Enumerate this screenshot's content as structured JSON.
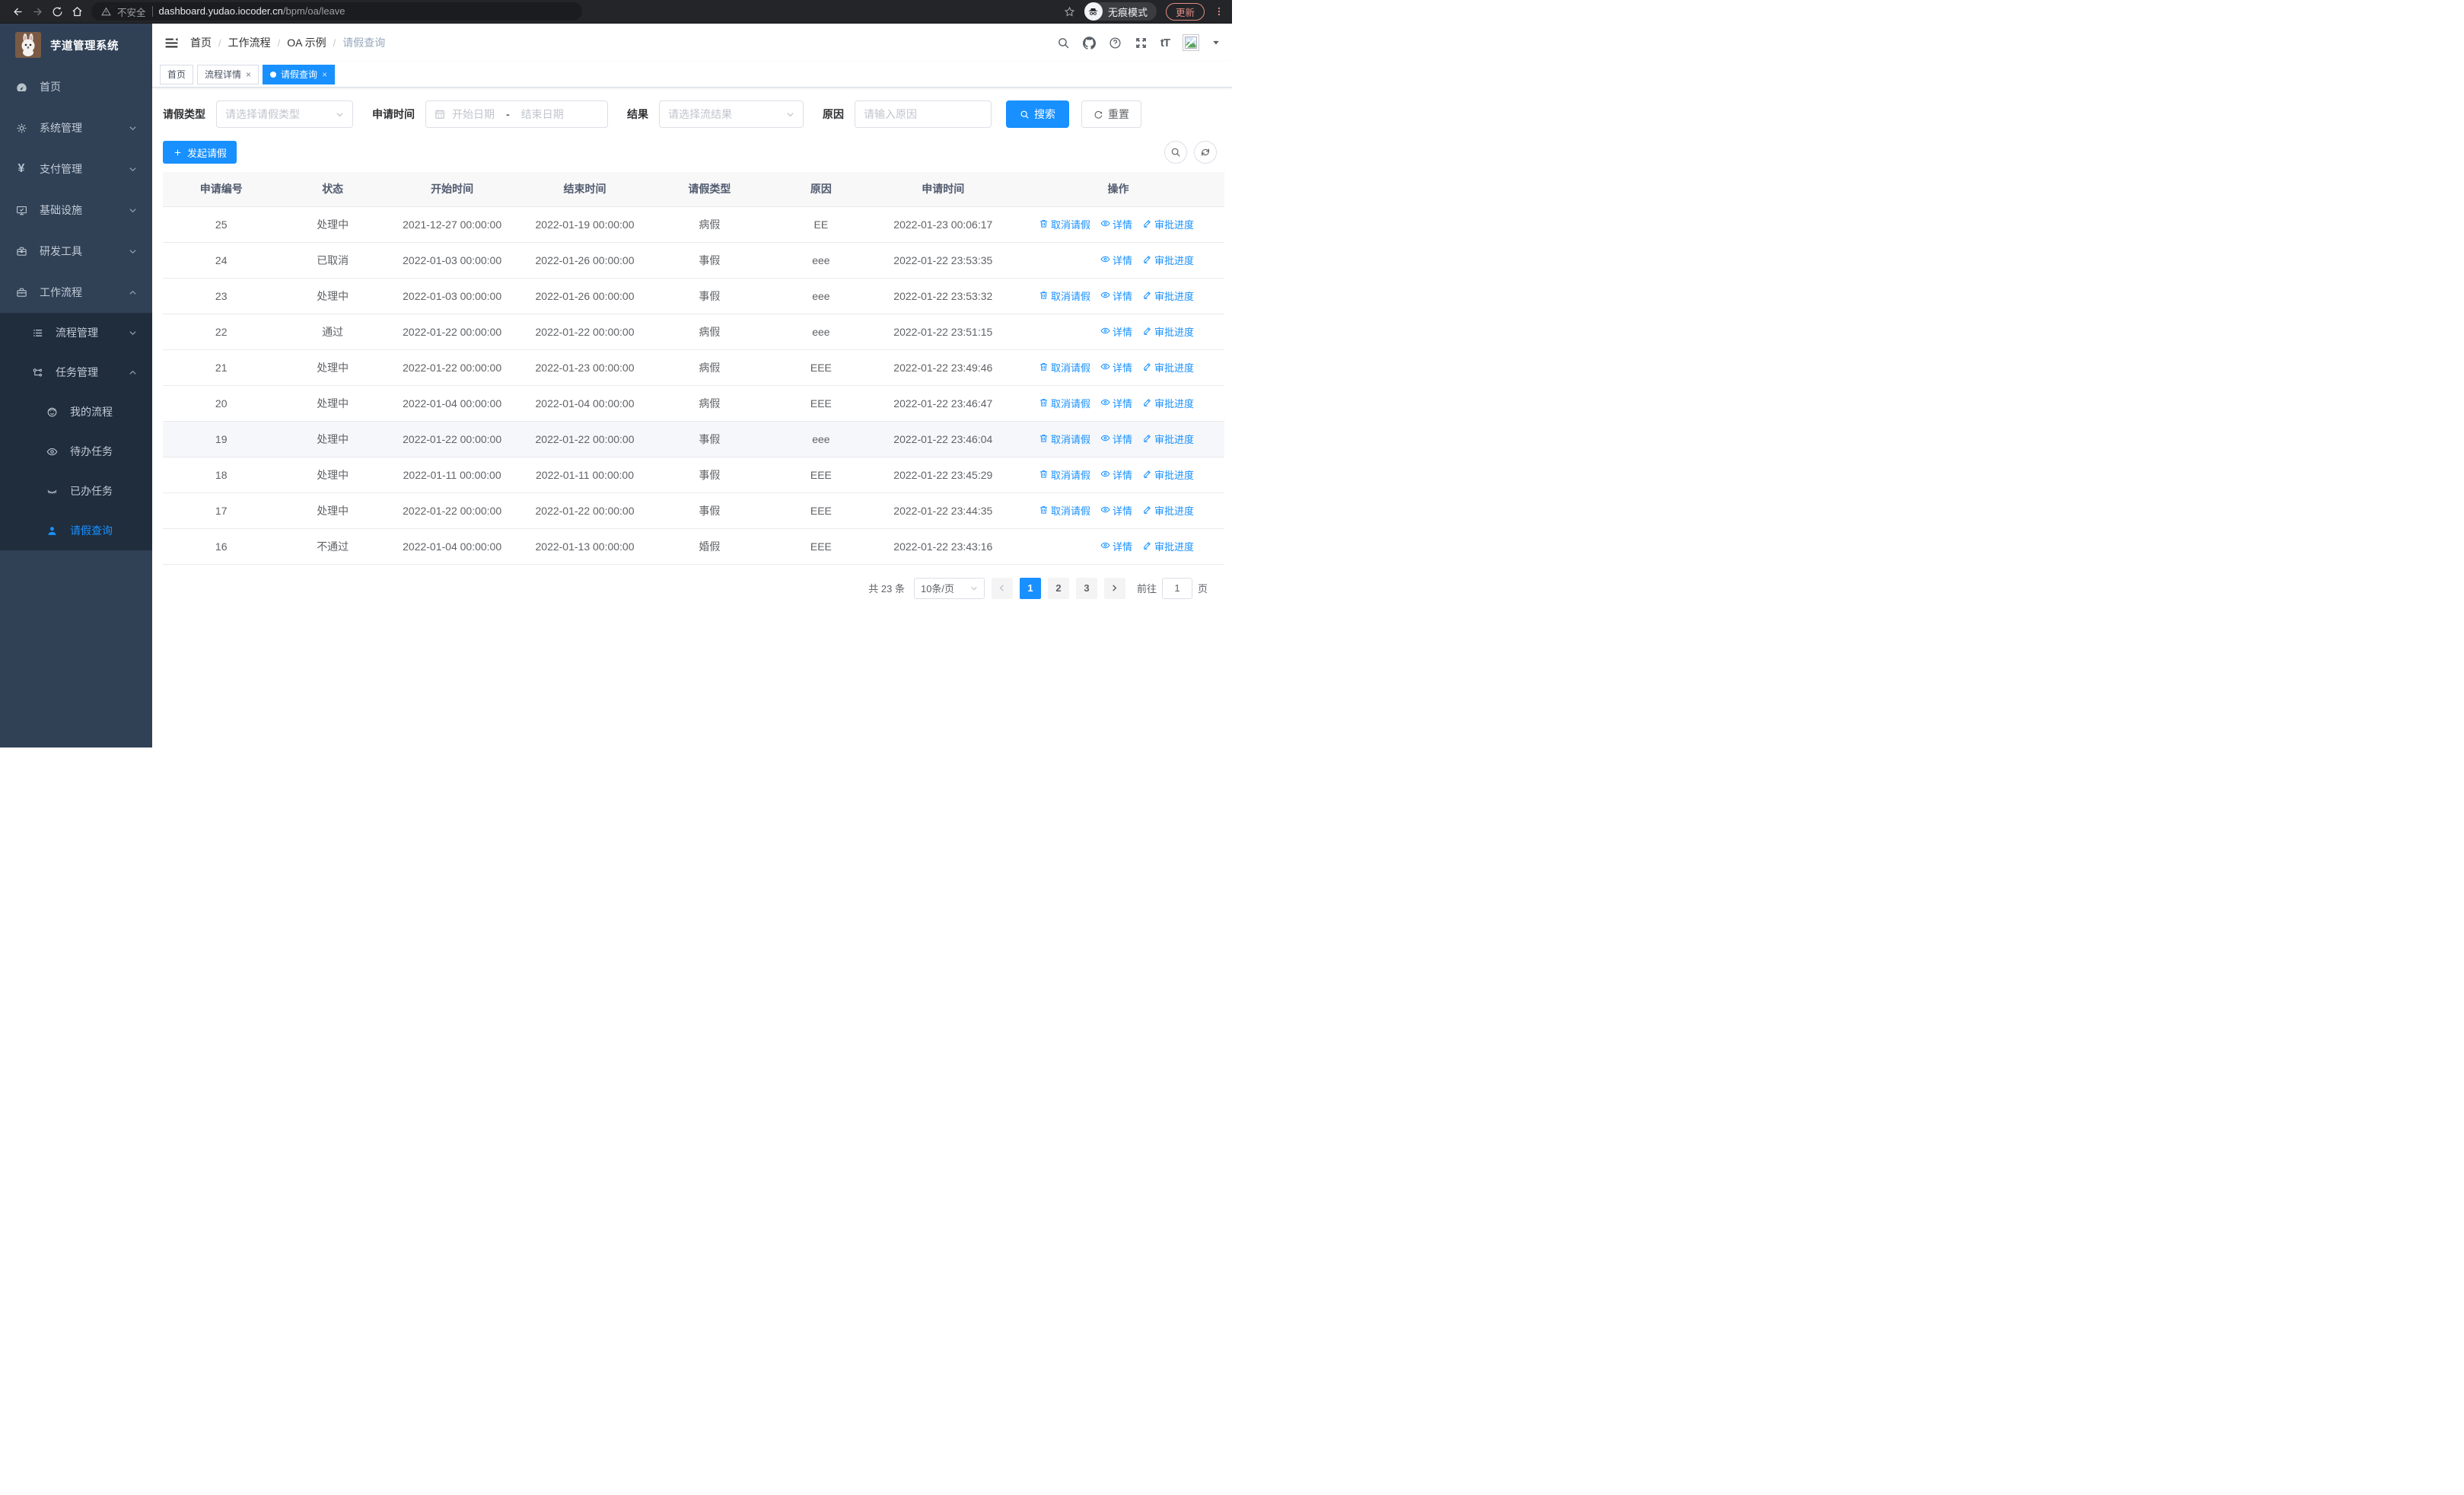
{
  "colors": {
    "accent": "#1890ff",
    "sidebar_bg": "#304156",
    "submenu_bg": "#1f2d3d"
  },
  "browser": {
    "security_label": "不安全",
    "url_host": "dashboard.yudao.iocoder.cn",
    "url_path": "/bpm/oa/leave",
    "incognito_label": "无痕模式",
    "update_label": "更新"
  },
  "sidebar": {
    "app_title": "芋道管理系统",
    "items": [
      {
        "label": "首页",
        "icon": "gauge-icon",
        "level": 1,
        "chevron": "",
        "active": false
      },
      {
        "label": "系统管理",
        "icon": "gear-icon",
        "level": 1,
        "chevron": "down",
        "active": false
      },
      {
        "label": "支付管理",
        "icon": "yen-icon",
        "level": 1,
        "chevron": "down",
        "active": false
      },
      {
        "label": "基础设施",
        "icon": "monitor-icon",
        "level": 1,
        "chevron": "down",
        "active": false
      },
      {
        "label": "研发工具",
        "icon": "toolbox-icon",
        "level": 1,
        "chevron": "down",
        "active": false
      },
      {
        "label": "工作流程",
        "icon": "briefcase-icon",
        "level": 1,
        "chevron": "up",
        "active": false
      },
      {
        "label": "流程管理",
        "icon": "tree-list-icon",
        "level": 2,
        "chevron": "down",
        "active": false
      },
      {
        "label": "任务管理",
        "icon": "flow-icon",
        "level": 2,
        "chevron": "up",
        "active": false
      },
      {
        "label": "我的流程",
        "icon": "face-icon",
        "level": 3,
        "chevron": "",
        "active": false
      },
      {
        "label": "待办任务",
        "icon": "eye-open-icon",
        "level": 3,
        "chevron": "",
        "active": false
      },
      {
        "label": "已办任务",
        "icon": "eye-closed-icon",
        "level": 3,
        "chevron": "",
        "active": false
      },
      {
        "label": "请假查询",
        "icon": "user-icon",
        "level": 3,
        "chevron": "",
        "active": true
      }
    ]
  },
  "breadcrumb": {
    "items": [
      "首页",
      "工作流程",
      "OA 示例",
      "请假查询"
    ]
  },
  "tabs": [
    {
      "label": "首页",
      "closable": false,
      "active": false
    },
    {
      "label": "流程详情",
      "closable": true,
      "active": false
    },
    {
      "label": "请假查询",
      "closable": true,
      "active": true
    }
  ],
  "filters": {
    "leave_type_label": "请假类型",
    "leave_type_placeholder": "请选择请假类型",
    "apply_time_label": "申请时间",
    "date_start_placeholder": "开始日期",
    "date_separator": "-",
    "date_end_placeholder": "结束日期",
    "result_label": "结果",
    "result_placeholder": "请选择流结果",
    "reason_label": "原因",
    "reason_placeholder": "请输入原因",
    "search_label": "搜索",
    "reset_label": "重置"
  },
  "toolbar": {
    "create_label": "发起请假"
  },
  "table": {
    "columns": [
      "申请编号",
      "状态",
      "开始时间",
      "结束时间",
      "请假类型",
      "原因",
      "申请时间",
      "操作"
    ],
    "action_labels": {
      "cancel": "取消请假",
      "detail": "详情",
      "progress": "审批进度"
    },
    "rows": [
      {
        "id": "25",
        "status": "处理中",
        "start": "2021-12-27 00:00:00",
        "end": "2022-01-19 00:00:00",
        "type": "病假",
        "reason": "EE",
        "apply_time": "2022-01-23 00:06:17",
        "cancelable": true,
        "highlight": false
      },
      {
        "id": "24",
        "status": "已取消",
        "start": "2022-01-03 00:00:00",
        "end": "2022-01-26 00:00:00",
        "type": "事假",
        "reason": "eee",
        "apply_time": "2022-01-22 23:53:35",
        "cancelable": false,
        "highlight": false
      },
      {
        "id": "23",
        "status": "处理中",
        "start": "2022-01-03 00:00:00",
        "end": "2022-01-26 00:00:00",
        "type": "事假",
        "reason": "eee",
        "apply_time": "2022-01-22 23:53:32",
        "cancelable": true,
        "highlight": false
      },
      {
        "id": "22",
        "status": "通过",
        "start": "2022-01-22 00:00:00",
        "end": "2022-01-22 00:00:00",
        "type": "病假",
        "reason": "eee",
        "apply_time": "2022-01-22 23:51:15",
        "cancelable": false,
        "highlight": false
      },
      {
        "id": "21",
        "status": "处理中",
        "start": "2022-01-22 00:00:00",
        "end": "2022-01-23 00:00:00",
        "type": "病假",
        "reason": "EEE",
        "apply_time": "2022-01-22 23:49:46",
        "cancelable": true,
        "highlight": false
      },
      {
        "id": "20",
        "status": "处理中",
        "start": "2022-01-04 00:00:00",
        "end": "2022-01-04 00:00:00",
        "type": "病假",
        "reason": "EEE",
        "apply_time": "2022-01-22 23:46:47",
        "cancelable": true,
        "highlight": false
      },
      {
        "id": "19",
        "status": "处理中",
        "start": "2022-01-22 00:00:00",
        "end": "2022-01-22 00:00:00",
        "type": "事假",
        "reason": "eee",
        "apply_time": "2022-01-22 23:46:04",
        "cancelable": true,
        "highlight": true
      },
      {
        "id": "18",
        "status": "处理中",
        "start": "2022-01-11 00:00:00",
        "end": "2022-01-11 00:00:00",
        "type": "事假",
        "reason": "EEE",
        "apply_time": "2022-01-22 23:45:29",
        "cancelable": true,
        "highlight": false
      },
      {
        "id": "17",
        "status": "处理中",
        "start": "2022-01-22 00:00:00",
        "end": "2022-01-22 00:00:00",
        "type": "事假",
        "reason": "EEE",
        "apply_time": "2022-01-22 23:44:35",
        "cancelable": true,
        "highlight": false
      },
      {
        "id": "16",
        "status": "不通过",
        "start": "2022-01-04 00:00:00",
        "end": "2022-01-13 00:00:00",
        "type": "婚假",
        "reason": "EEE",
        "apply_time": "2022-01-22 23:43:16",
        "cancelable": false,
        "highlight": false
      }
    ]
  },
  "pagination": {
    "total_text": "共 23 条",
    "page_size_value": "10条/页",
    "pages": [
      "1",
      "2",
      "3"
    ],
    "active_page": "1",
    "goto_label": "前往",
    "goto_value": "1",
    "goto_suffix": "页"
  }
}
